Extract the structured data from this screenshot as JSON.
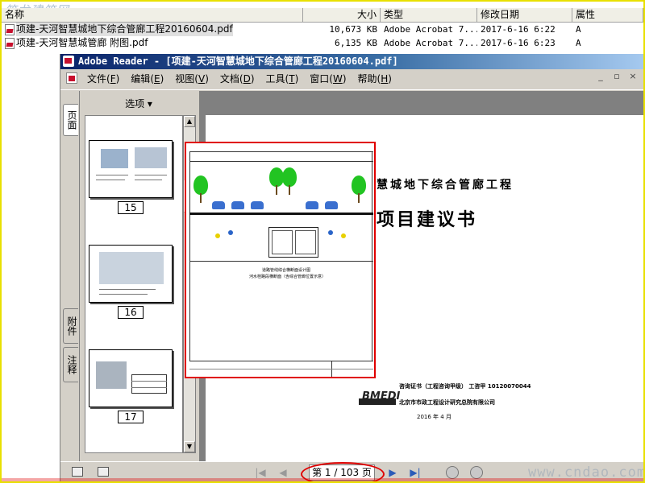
{
  "explorer": {
    "watermark": "筑龙建筑网",
    "columns": [
      "名称",
      "大小",
      "类型",
      "修改日期",
      "属性"
    ],
    "files": [
      {
        "name": "项建-天河智慧城地下综合管廊工程20160604.pdf",
        "size": "10,673 KB",
        "type": "Adobe Acrobat 7...",
        "date": "2017-6-16 6:22",
        "attr": "A",
        "selected": true
      },
      {
        "name": "项建-天河智慧城管廊 附图.pdf",
        "size": "6,135 KB",
        "type": "Adobe Acrobat 7...",
        "date": "2017-6-16 6:23",
        "attr": "A",
        "selected": false
      }
    ]
  },
  "window": {
    "title": "Adobe Reader - [项建-天河智慧城地下综合管廊工程20160604.pdf]",
    "icon": "adobe-reader-icon"
  },
  "menu": {
    "items": [
      {
        "label": "文件",
        "key": "F"
      },
      {
        "label": "编辑",
        "key": "E"
      },
      {
        "label": "视图",
        "key": "V"
      },
      {
        "label": "文档",
        "key": "D"
      },
      {
        "label": "工具",
        "key": "T"
      },
      {
        "label": "窗口",
        "key": "W"
      },
      {
        "label": "帮助",
        "key": "H"
      }
    ]
  },
  "side_tabs": {
    "pages": "页面",
    "attachments": "附件",
    "comments": "注释"
  },
  "thumbnails": {
    "options_label": "选项",
    "pages": [
      "15",
      "16",
      "17"
    ]
  },
  "document": {
    "title_line": "慧城地下综合管廊工程",
    "subtitle": "项目建议书",
    "logo_text": "BMEDI",
    "cert_line": "咨询证书（工程咨询甲级） 工咨甲 10120070044",
    "institute": "北京市市政工程设计研究总院有限公司",
    "date": "2016 年 4 月"
  },
  "preview": {
    "caption_1": "道路管线综合横断面设计图",
    "caption_2": "河水桂路段横断面（含综合管廊位置示意）"
  },
  "status": {
    "page_indicator": "第 1 / 103 页",
    "site_watermark": "www.cndao.com"
  },
  "colors": {
    "title_bar": "#0a246a",
    "window_chrome": "#d4d0c8",
    "highlight": "#e00000",
    "tree": "#22c422",
    "car": "#3a6fcf"
  }
}
